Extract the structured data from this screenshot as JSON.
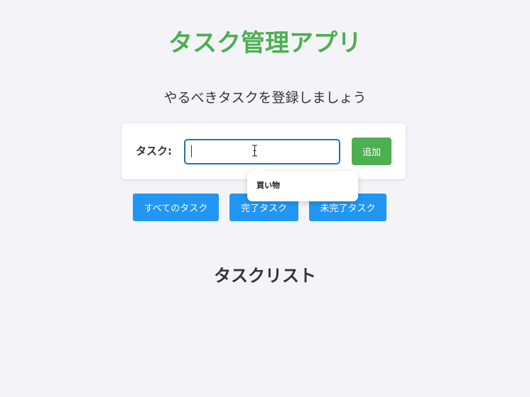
{
  "header": {
    "title": "タスク管理アプリ",
    "subtitle": "やるべきタスクを登録しましょう"
  },
  "form": {
    "label": "タスク:",
    "input_value": "",
    "add_label": "追加"
  },
  "autocomplete": {
    "items": [
      "買い物"
    ]
  },
  "filters": {
    "all_label": "すべてのタスク",
    "done_label": "完了タスク",
    "undone_label": "未完了タスク"
  },
  "task_list": {
    "title": "タスクリスト"
  },
  "colors": {
    "accent_green": "#4caf50",
    "filter_blue": "#2196f3",
    "input_border": "#2a6fa8",
    "background": "#f4f4f8"
  }
}
